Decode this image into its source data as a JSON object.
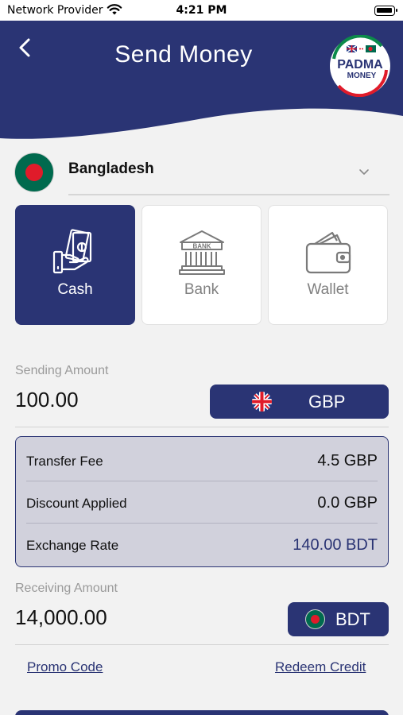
{
  "status_bar": {
    "carrier": "Network Provider",
    "time": "4:21 PM"
  },
  "header": {
    "title": "Send Money",
    "logo_text_top": "PADMA",
    "logo_text_bottom": "MONEY"
  },
  "country": {
    "name": "Bangladesh",
    "flag_icon": "bangladesh-flag-icon"
  },
  "methods": [
    {
      "label": "Cash",
      "icon": "cash-hand-icon",
      "selected": true
    },
    {
      "label": "Bank",
      "icon": "bank-building-icon",
      "selected": false
    },
    {
      "label": "Wallet",
      "icon": "wallet-icon",
      "selected": false
    }
  ],
  "sending": {
    "label": "Sending Amount",
    "value": "100.00",
    "currency": "GBP",
    "flag_icon": "uk-flag-icon"
  },
  "fees": [
    {
      "label": "Transfer Fee",
      "value": "4.5 GBP"
    },
    {
      "label": "Discount Applied",
      "value": "0.0 GBP"
    },
    {
      "label": "Exchange Rate",
      "value": "140.00 BDT"
    }
  ],
  "receiving": {
    "label": "Receiving Amount",
    "value": "14,000.00",
    "currency": "BDT",
    "flag_icon": "bangladesh-flag-icon"
  },
  "links": {
    "promo": "Promo Code",
    "redeem": "Redeem Credit"
  },
  "colors": {
    "primary": "#2a3474",
    "fees_card_bg": "#d1d1dc",
    "page_bg": "#f2f2f2"
  }
}
